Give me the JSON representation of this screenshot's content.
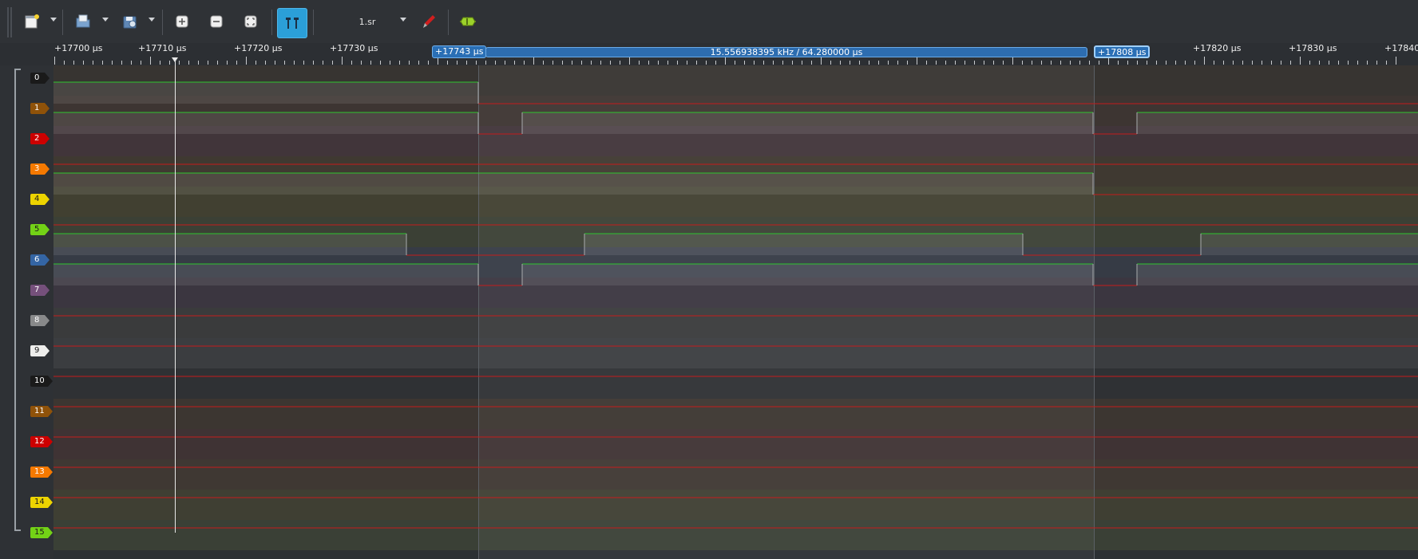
{
  "toolbar": {
    "buttons": [
      {
        "name": "new-session-icon"
      },
      {
        "name": "open-file-icon"
      },
      {
        "name": "save-file-icon"
      },
      {
        "name": "zoom-in-icon"
      },
      {
        "name": "zoom-out-icon"
      },
      {
        "name": "zoom-fit-icon"
      },
      {
        "name": "cursor-toggle-icon"
      }
    ],
    "session_label": "1.sr"
  },
  "ruler": {
    "ticks": [
      "+17700 µs",
      "+17710 µs",
      "+17720 µs",
      "+17730 µs",
      "+17820 µs",
      "+17830 µs",
      "+17840"
    ],
    "cursor_a": "+17743 µs",
    "cursor_b": "+17808 µs",
    "measurement": "15.556938395 kHz / 64.280000 µs"
  },
  "channels": [
    {
      "label": "0",
      "color": "#1a1a1a",
      "text": "#ffffff"
    },
    {
      "label": "1",
      "color": "#8f5209",
      "text": "#ffffff"
    },
    {
      "label": "2",
      "color": "#cc0000",
      "text": "#ffffff"
    },
    {
      "label": "3",
      "color": "#f57900",
      "text": "#ffffff"
    },
    {
      "label": "4",
      "color": "#edd400",
      "text": "#1a1a1a"
    },
    {
      "label": "5",
      "color": "#73d216",
      "text": "#1a1a1a"
    },
    {
      "label": "6",
      "color": "#3465a4",
      "text": "#ffffff"
    },
    {
      "label": "7",
      "color": "#75507b",
      "text": "#ffffff"
    },
    {
      "label": "8",
      "color": "#88898a",
      "text": "#ffffff"
    },
    {
      "label": "9",
      "color": "#eeeeec",
      "text": "#1a1a1a"
    },
    {
      "label": "10",
      "color": "#1a1a1a",
      "text": "#ffffff"
    },
    {
      "label": "11",
      "color": "#8f5209",
      "text": "#ffffff"
    },
    {
      "label": "12",
      "color": "#cc0000",
      "text": "#ffffff"
    },
    {
      "label": "13",
      "color": "#f57900",
      "text": "#ffffff"
    },
    {
      "label": "14",
      "color": "#edd400",
      "text": "#1a1a1a"
    },
    {
      "label": "15",
      "color": "#73d216",
      "text": "#1a1a1a"
    }
  ]
}
